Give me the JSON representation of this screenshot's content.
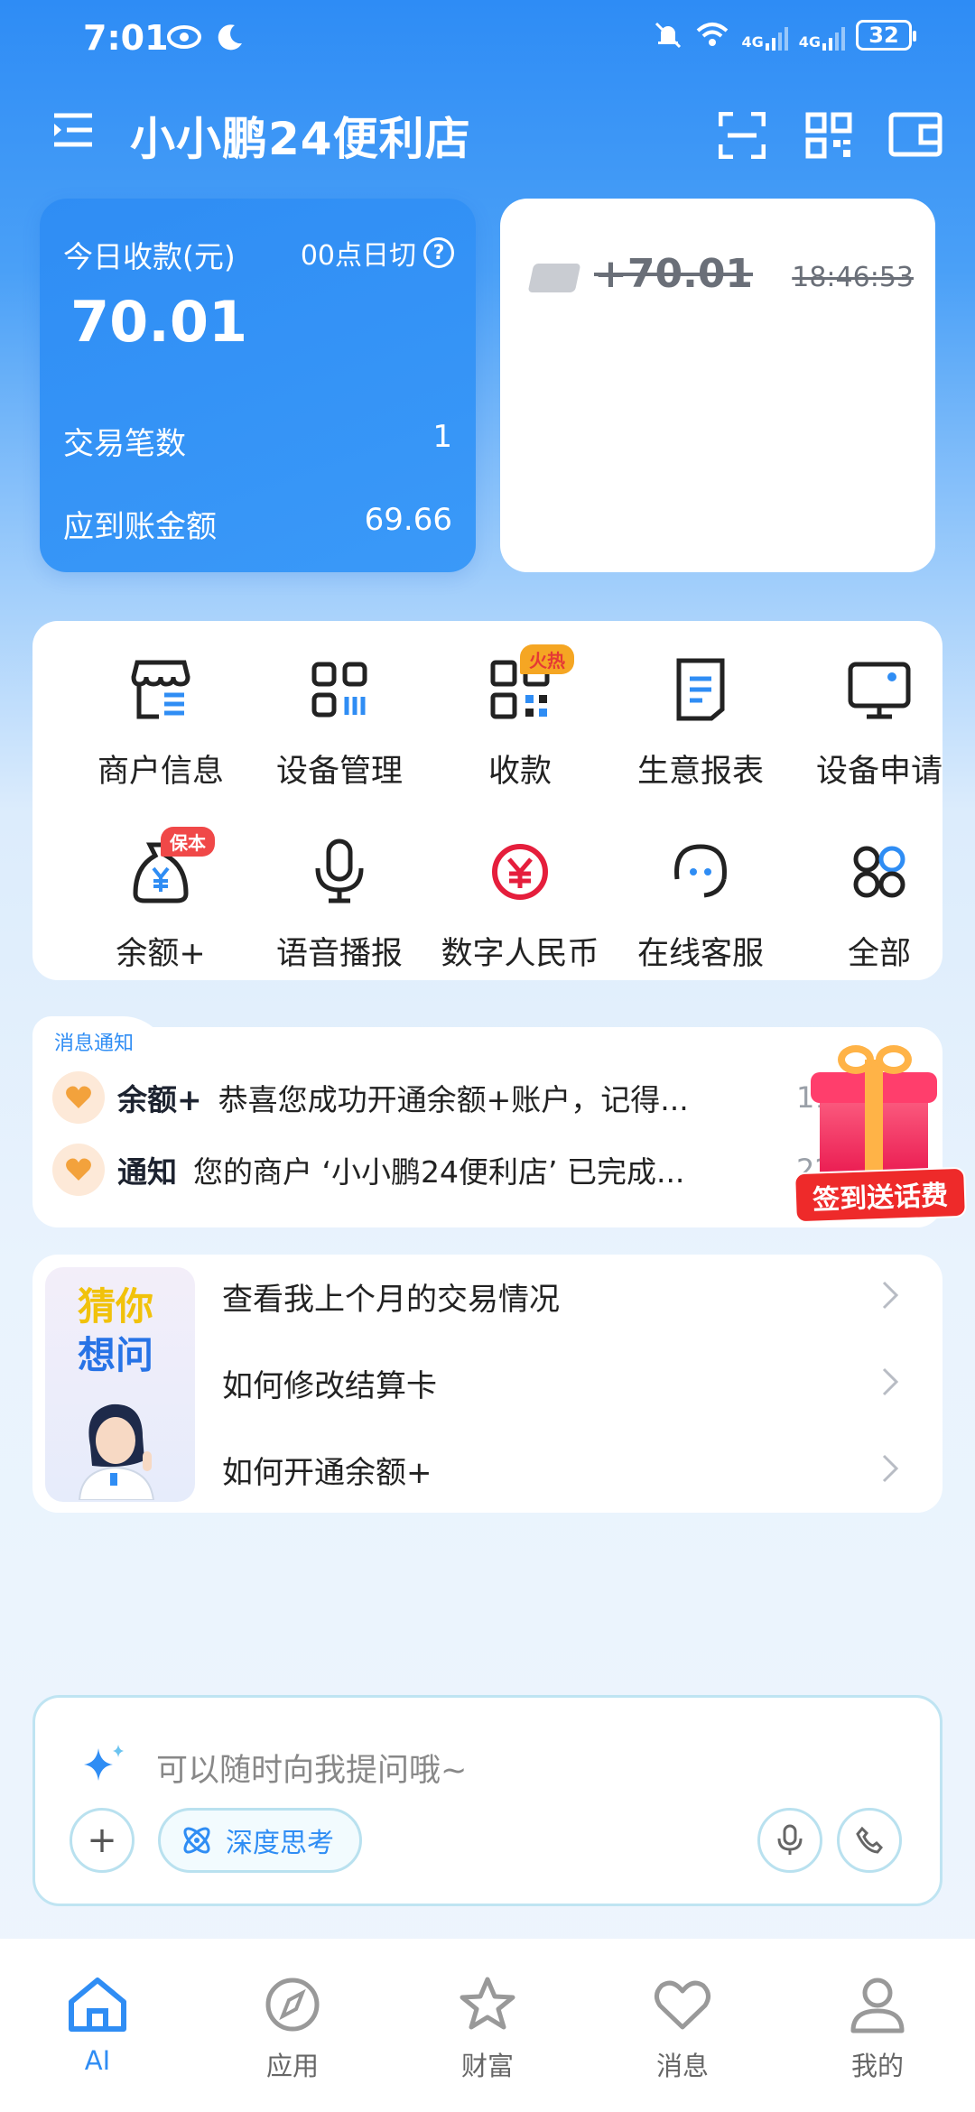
{
  "status_bar": {
    "time": "7:01",
    "battery": "32",
    "net1": "4G",
    "net2": "4G"
  },
  "header": {
    "title": "小小鹏24便利店"
  },
  "income_card": {
    "label": "今日收款(元)",
    "cutoff": "00点日切",
    "help": "?",
    "amount": "70.01",
    "count_label": "交易笔数",
    "count_value": "1",
    "settle_label": "应到账金额",
    "settle_value": "69.66"
  },
  "transaction": {
    "amount": "+70.01",
    "time": "18:46:53"
  },
  "functions": [
    {
      "label": "商户信息",
      "icon": "store-icon"
    },
    {
      "label": "设备管理",
      "icon": "device-grid-icon"
    },
    {
      "label": "收款",
      "icon": "qr-pay-icon",
      "badge": "火热"
    },
    {
      "label": "生意报表",
      "icon": "report-icon"
    },
    {
      "label": "设备申请",
      "icon": "monitor-icon"
    },
    {
      "label": "余额+",
      "icon": "money-bag-icon",
      "badge": "保本"
    },
    {
      "label": "语音播报",
      "icon": "microphone-icon"
    },
    {
      "label": "数字人民币",
      "icon": "digital-rmb-icon"
    },
    {
      "label": "在线客服",
      "icon": "headset-icon"
    },
    {
      "label": "全部",
      "icon": "all-apps-icon"
    }
  ],
  "notices": {
    "tab": "消息通知",
    "items": [
      {
        "kind": "余额+",
        "text": "恭喜您成功开通余额+账户，记得...",
        "num": "11"
      },
      {
        "kind": "通知",
        "text": "您的商户 ‘小小鹏24便利店’ 已完成...",
        "num": "22"
      }
    ]
  },
  "gift": {
    "label": "签到送话费"
  },
  "guess": {
    "title_line1": "猜你",
    "title_line2": "想问",
    "items": [
      "查看我上个月的交易情况",
      "如何修改结算卡",
      "如何开通余额+"
    ]
  },
  "input": {
    "placeholder": "可以随时向我提问哦~",
    "deep_think": "深度思考",
    "plus": "+"
  },
  "bottom_nav": [
    {
      "label": "AI",
      "icon": "home-icon"
    },
    {
      "label": "应用",
      "icon": "compass-icon"
    },
    {
      "label": "财富",
      "icon": "star-icon"
    },
    {
      "label": "消息",
      "icon": "heart-icon"
    },
    {
      "label": "我的",
      "icon": "person-icon"
    }
  ],
  "colors": {
    "primary": "#2f8df4",
    "accent_orange": "#f5a623",
    "accent_red": "#e8134b"
  }
}
